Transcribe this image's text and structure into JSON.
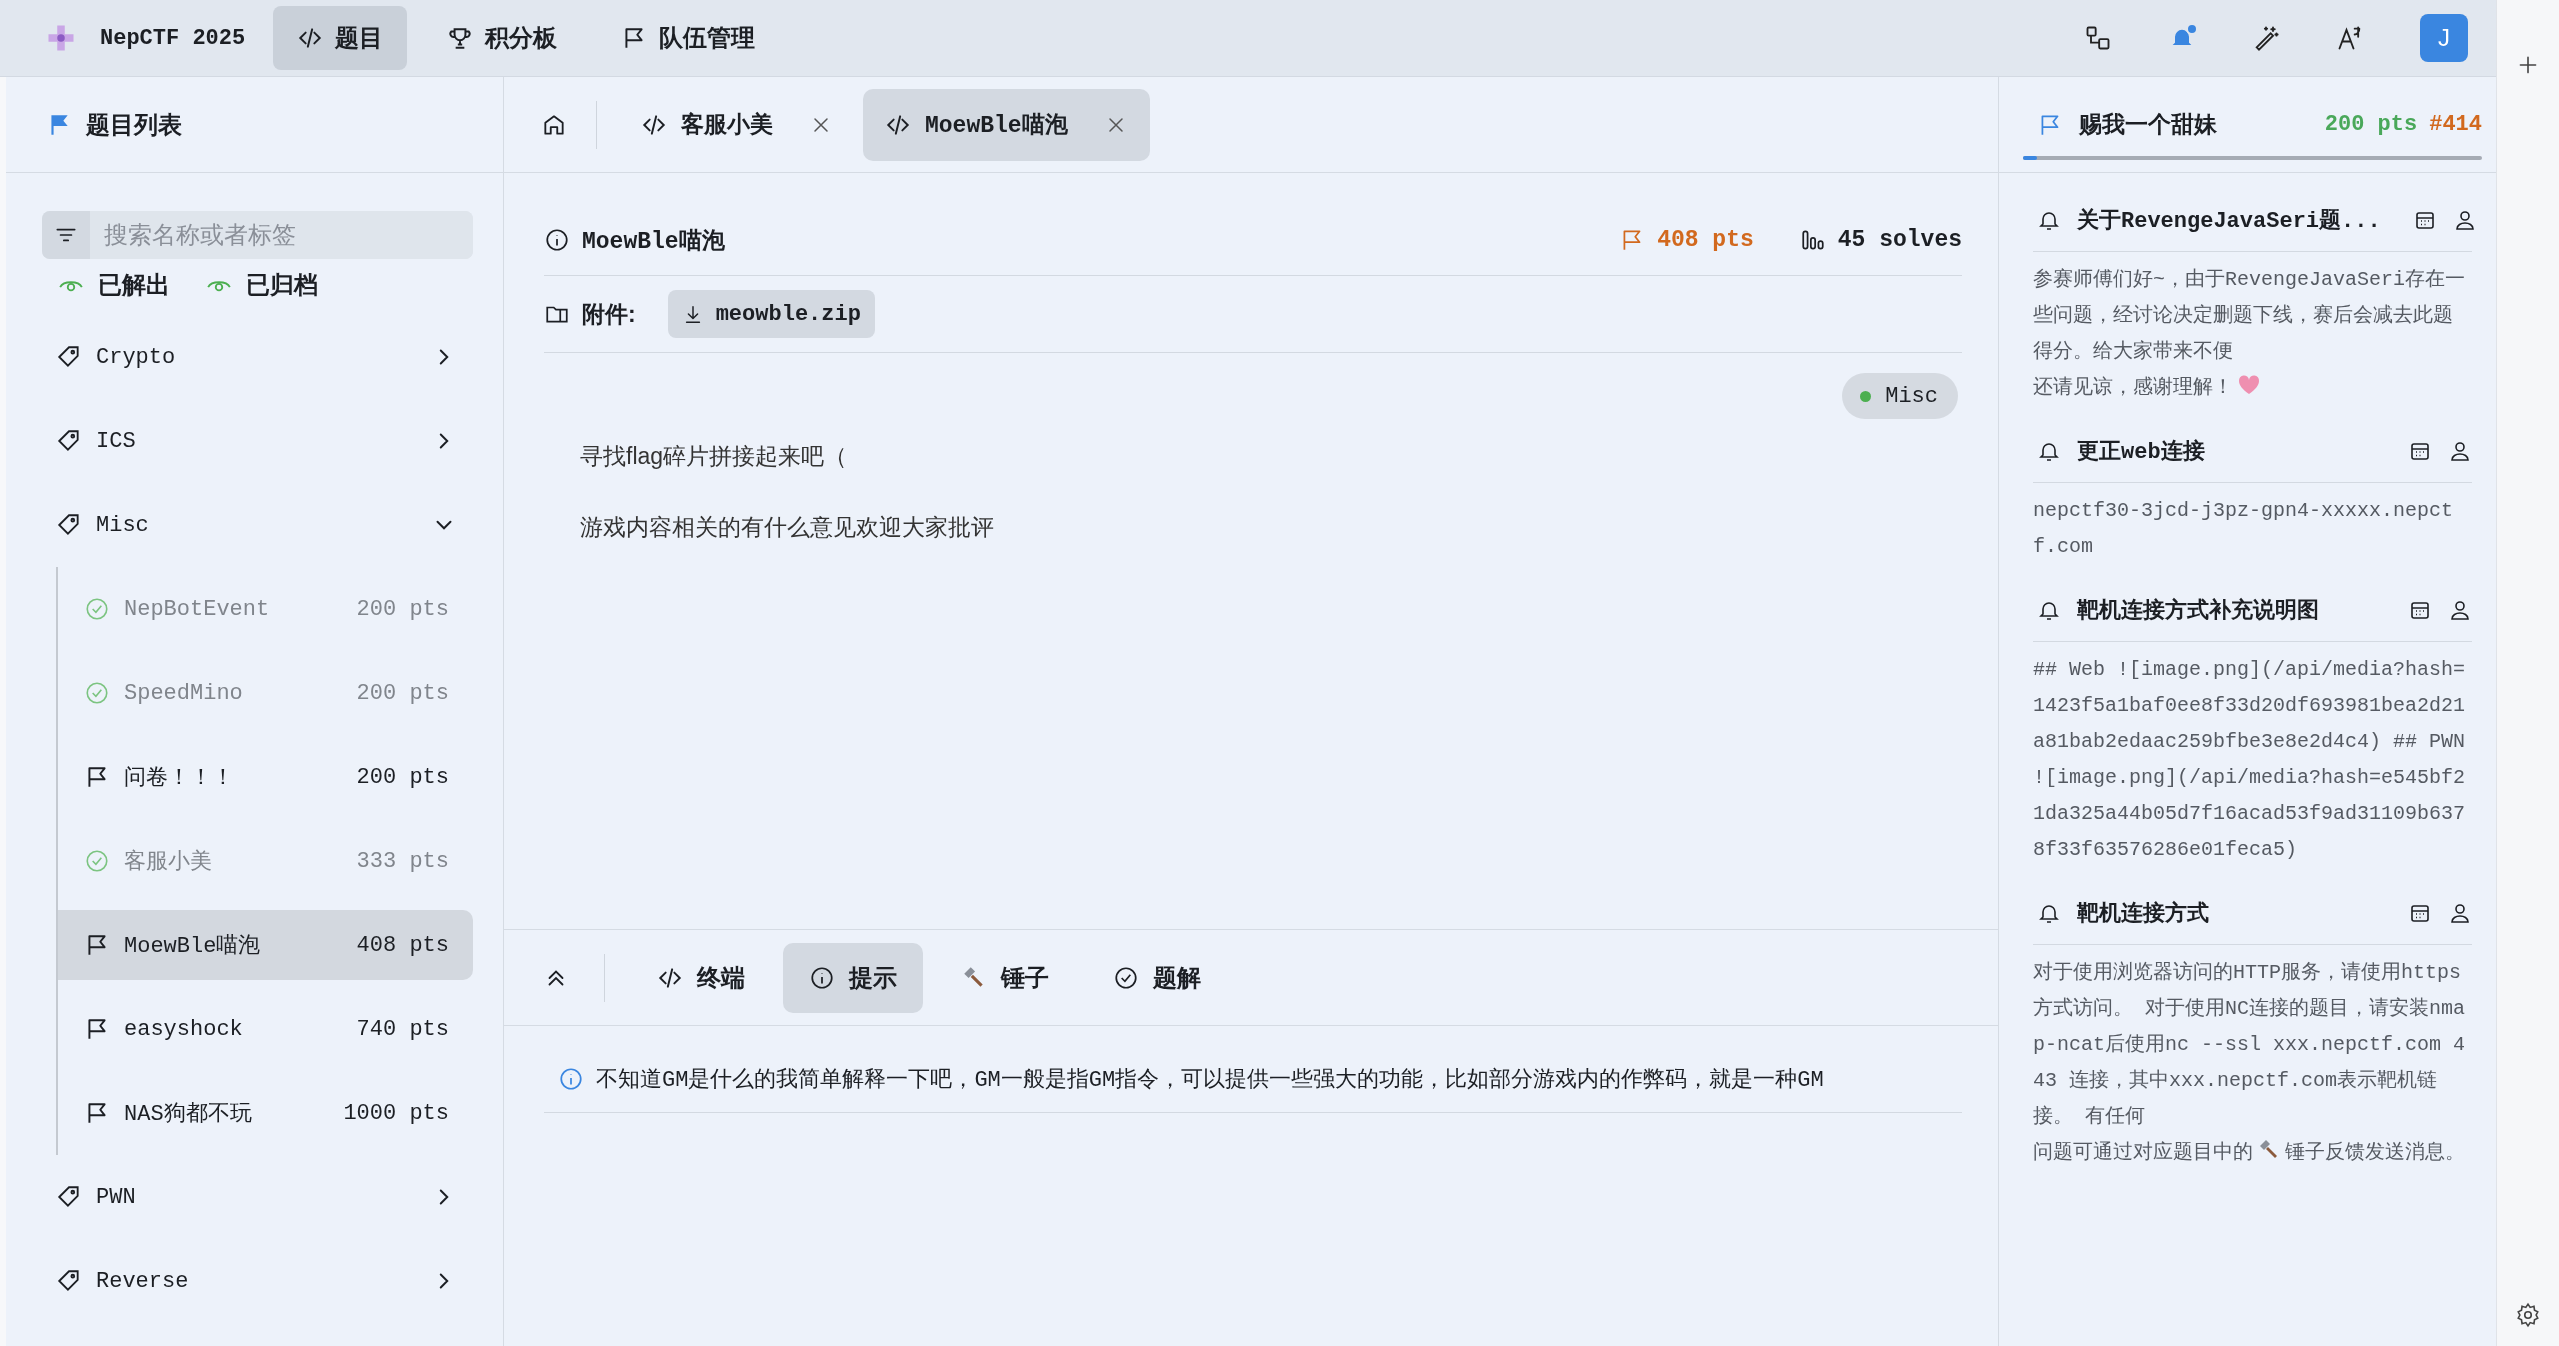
{
  "app": {
    "name": "NepCTF 2025"
  },
  "nav": [
    {
      "label": "题目",
      "kind": "code",
      "selected": true
    },
    {
      "label": "积分板",
      "kind": "trophy",
      "selected": false
    },
    {
      "label": "队伍管理",
      "kind": "flag",
      "selected": false
    }
  ],
  "toolbar": [
    {
      "kind": "switch",
      "unread": false
    },
    {
      "kind": "bell",
      "unread": true
    },
    {
      "kind": "wand",
      "unread": false
    },
    {
      "kind": "font",
      "unread": false
    }
  ],
  "user": {
    "initial": "J"
  },
  "sidebar": {
    "title": "题目列表",
    "search": {
      "placeholder": "搜索名称或者标签"
    },
    "filters": [
      {
        "label": "已解出"
      },
      {
        "label": "已归档"
      }
    ],
    "categories": [
      {
        "name": "Crypto",
        "expanded": false
      },
      {
        "name": "ICS",
        "expanded": false
      },
      {
        "name": "Misc",
        "expanded": true,
        "children": [
          {
            "name": "NepBotEvent",
            "points": "200 pts",
            "solved": true,
            "selected": false
          },
          {
            "name": "SpeedMino",
            "points": "200 pts",
            "solved": true,
            "selected": false
          },
          {
            "name": "问卷！！！",
            "points": "200 pts",
            "solved": false,
            "selected": false
          },
          {
            "name": "客服小美",
            "points": "333 pts",
            "solved": true,
            "selected": false
          },
          {
            "name": "MoewBle喵泡",
            "points": "408 pts",
            "solved": false,
            "selected": true
          },
          {
            "name": "easyshock",
            "points": "740 pts",
            "solved": false,
            "selected": false
          },
          {
            "name": "NAS狗都不玩",
            "points": "1000 pts",
            "solved": false,
            "selected": false
          }
        ]
      },
      {
        "name": "PWN",
        "expanded": false
      },
      {
        "name": "Reverse",
        "expanded": false
      }
    ]
  },
  "tabs": [
    {
      "kind": "home"
    },
    {
      "kind": "challenge",
      "label": "客服小美",
      "selected": false
    },
    {
      "kind": "challenge",
      "label": "MoewBle喵泡",
      "selected": true
    }
  ],
  "challenge": {
    "title": "MoewBle喵泡",
    "points": "408 pts",
    "solves": "45 solves",
    "attachment_label": "附件:",
    "attachment": "meowble.zip",
    "tag": {
      "label": "Misc",
      "color": "#4caf50"
    },
    "description": [
      "寻找flag碎片拼接起来吧（",
      "游戏内容相关的有什么意见欢迎大家批评"
    ]
  },
  "panel_tabs": [
    {
      "label": "终端",
      "kind": "code",
      "selected": false
    },
    {
      "label": "提示",
      "kind": "info",
      "selected": true
    },
    {
      "label": "锤子",
      "kind": "hammer",
      "selected": false
    },
    {
      "label": "题解",
      "kind": "check",
      "selected": false
    }
  ],
  "hints": [
    "不知道GM是什么的我简单解释一下吧，GM一般是指GM指令，可以提供一些强大的功能，比如部分游戏内的作弊码，就是一种GM"
  ],
  "team": {
    "name": "赐我一个甜妹",
    "points": "200 pts",
    "rank": "#414",
    "level": 0.03
  },
  "announcements": [
    {
      "title": "关于RevengeJavaSeri题...",
      "body": [
        {
          "kind": "text",
          "text": "参赛师傅们好~，由于RevengeJavaSeri存在一些问题，经讨论决定删题下线，赛后会减去此题得分。给大家带来不便"
        },
        {
          "kind": "line",
          "text": "还请见谅，感谢理解！"
        },
        {
          "kind": "heart"
        }
      ]
    },
    {
      "title": "更正web连接",
      "body": [
        {
          "kind": "text",
          "text": "nepctf30-3jcd-j3pz-gpn4-xxxxx.nepctf.com"
        }
      ]
    },
    {
      "title": "靶机连接方式补充说明图",
      "body": [
        {
          "kind": "text",
          "text": "## Web ![image.png](/api/media?hash=1423f5a1baf0ee8f33d20df693981bea2d21a81bab2edaac259bfbe3e8e2d4c4) ## PWN ![image.png](/api/media?hash=e545bf21da325a44b05d7f16acad53f9ad31109b6378f33f63576286e01feca5)"
        }
      ]
    },
    {
      "title": "靶机连接方式",
      "body": [
        {
          "kind": "text",
          "text": "对于使用浏览器访问的HTTP服务，请使用https方式访问。 对于使用NC连接的题目，请安装nmap-ncat后使用nc --ssl xxx.nepctf.com 443 连接，其中xxx.nepctf.com表示靶机链接。 有任何"
        },
        {
          "kind": "line",
          "text": "问题可通过对应题目中的"
        },
        {
          "kind": "hammer"
        },
        {
          "kind": "line",
          "text": "锤子反馈发送消息。"
        }
      ]
    }
  ]
}
